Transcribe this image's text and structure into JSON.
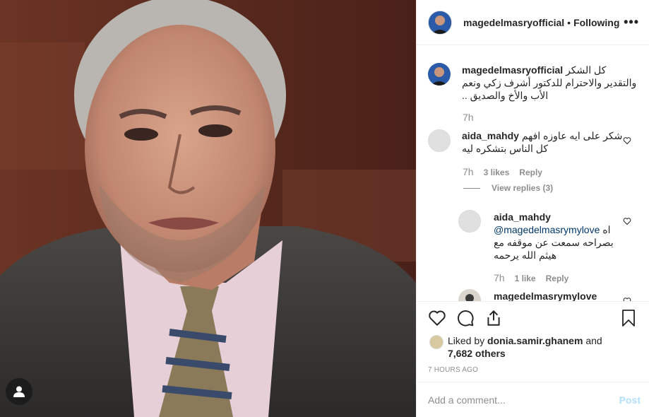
{
  "post": {
    "username": "magedelmasryofficial",
    "follow_status": "Following",
    "separator": "•",
    "more": "•••"
  },
  "caption": {
    "username": "magedelmasryofficial",
    "text": "كل الشكر والتقدير والاحترام للدكتور أشرف زكي ونعم الأب والأخ والصديق ..",
    "time": "7h"
  },
  "comments": [
    {
      "username": "aida_mahdy",
      "text": "شكر على ايه عاوزه افهم كل الناس بتشكره ليه",
      "time": "7h",
      "likes": "3 likes",
      "reply": "Reply",
      "view_replies": "View replies (3)"
    }
  ],
  "replies": [
    {
      "username": "aida_mahdy",
      "mention": "@magedelmasrymylove",
      "text": "اه بصراحه سمعت عن موقفه مع هيثم الله يرحمه",
      "time": "7h",
      "likes": "1 like",
      "reply": "Reply"
    },
    {
      "username": "magedelmasrymylove"
    }
  ],
  "likes": {
    "prefix": "Liked by",
    "user": "donia.samir.ghanem",
    "and": "and",
    "others": "7,682 others"
  },
  "timestamp": "7 HOURS AGO",
  "add_comment": {
    "placeholder": "Add a comment...",
    "post": "Post"
  },
  "colors": {
    "link": "#00376b",
    "muted": "#8e8e8e",
    "post_disabled": "#b2dffc"
  }
}
